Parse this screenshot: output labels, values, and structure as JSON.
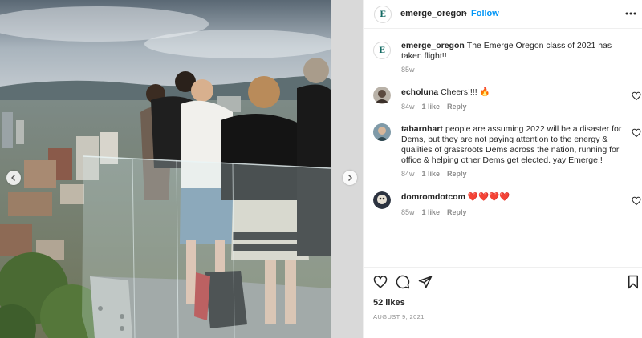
{
  "photo": {
    "alt_subject": "people on glass balcony overlooking city",
    "prev_icon": "chevron-left-icon",
    "next_icon": "chevron-right-icon"
  },
  "header": {
    "avatar_letter": "E",
    "username": "emerge_oregon",
    "dot": "•",
    "follow_label": "Follow",
    "more_icon": "more-horizontal-icon"
  },
  "caption": {
    "avatar_letter": "E",
    "username": "emerge_oregon",
    "text": "The Emerge Oregon class of 2021 has taken flight!!",
    "time": "85w"
  },
  "comments": [
    {
      "username": "echoluna",
      "text": "Cheers!!!! 🔥",
      "time": "84w",
      "likes": "1 like",
      "reply": "Reply"
    },
    {
      "username": "tabarnhart",
      "text": "people are assuming 2022 will be a disaster for Dems, but they are not paying attention to the energy & qualities of grassroots Dems across the nation, running for office & helping other Dems get elected. yay Emerge!!",
      "time": "84w",
      "likes": "1 like",
      "reply": "Reply"
    },
    {
      "username": "domromdotcom",
      "text": "❤️❤️❤️❤️",
      "time": "85w",
      "likes": "1 like",
      "reply": "Reply"
    }
  ],
  "actions": {
    "like_icon": "heart-icon",
    "comment_icon": "comment-icon",
    "share_icon": "send-icon",
    "save_icon": "bookmark-icon"
  },
  "likes_count": "52 likes",
  "date": "AUGUST 9, 2021",
  "colors": {
    "link": "#0095f6",
    "text": "#262626",
    "muted": "#8e8e8e",
    "border": "#efefef",
    "brand": "#136a63"
  }
}
